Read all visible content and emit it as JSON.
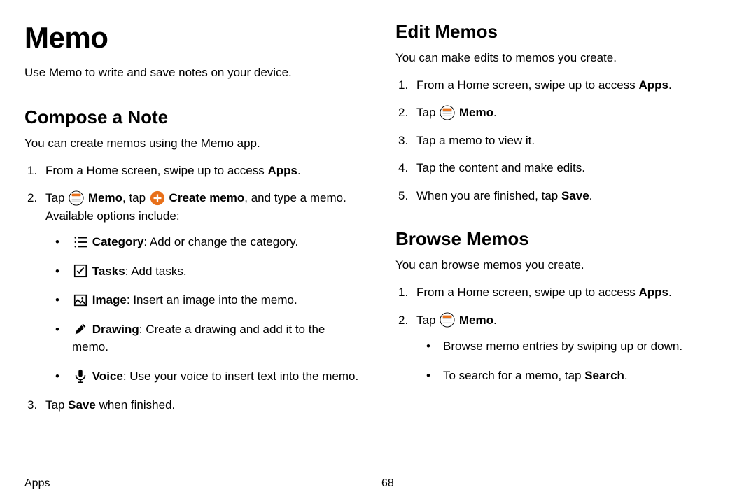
{
  "title": "Memo",
  "intro": "Use Memo to write and save notes on your device.",
  "footer": {
    "section": "Apps",
    "page": "68"
  },
  "left": {
    "h2": "Compose a Note",
    "desc": "You can create memos using the Memo app.",
    "step1_pre": "From a Home screen, swipe up to access ",
    "step1_bold": "Apps",
    "step1_post": ".",
    "step2_p1": "Tap ",
    "step2_memo": "Memo",
    "step2_p2": ", tap ",
    "step2_create": "Create memo",
    "step2_p3": ", and type a memo. Available options include:",
    "opt_category_b": "Category",
    "opt_category_t": ": Add or change the category.",
    "opt_tasks_b": "Tasks",
    "opt_tasks_t": ": Add tasks.",
    "opt_image_b": "Image",
    "opt_image_t": ": Insert an image into the memo.",
    "opt_drawing_b": "Drawing",
    "opt_drawing_t": ": Create a drawing and add it to the memo.",
    "opt_voice_b": "Voice",
    "opt_voice_t": ": Use your voice to insert text into the memo.",
    "step3_p1": "Tap ",
    "step3_b": "Save",
    "step3_p2": " when finished."
  },
  "right": {
    "edit_h2": "Edit Memos",
    "edit_desc": "You can make edits to memos you create.",
    "e1_pre": "From a Home screen, swipe up to access ",
    "e1_bold": "Apps",
    "e1_post": ".",
    "e2_p1": "Tap ",
    "e2_b": "Memo",
    "e2_p2": ".",
    "e3": "Tap a memo to view it.",
    "e4": "Tap the content and make edits.",
    "e5_p1": "When you are finished, tap ",
    "e5_b": "Save",
    "e5_p2": ".",
    "browse_h2": "Browse Memos",
    "browse_desc": "You can browse memos you create.",
    "b1_pre": "From a Home screen, swipe up to access ",
    "b1_bold": "Apps",
    "b1_post": ".",
    "b2_p1": "Tap ",
    "b2_b": "Memo",
    "b2_p2": ".",
    "b_sub1": "Browse memo entries by swiping up or down.",
    "b_sub2_p1": "To search for a memo, tap ",
    "b_sub2_b": "Search",
    "b_sub2_p2": "."
  }
}
